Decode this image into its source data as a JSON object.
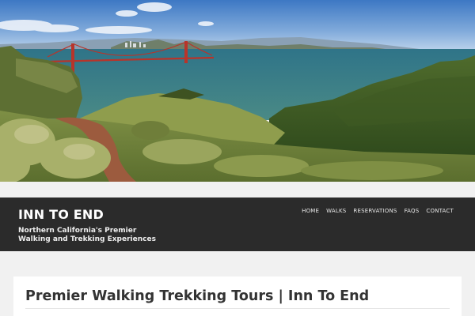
{
  "hero": {
    "image_description": "Golden Gate Bridge panorama"
  },
  "site": {
    "title": "INN TO END",
    "tagline": [
      "Northern California's Premier",
      "Walking and Trekking Experiences"
    ]
  },
  "nav": {
    "items": [
      {
        "label": "HOME"
      },
      {
        "label": "WALKS"
      },
      {
        "label": "RESERVATIONS"
      },
      {
        "label": "FAQS"
      },
      {
        "label": "CONTACT"
      }
    ]
  },
  "content": {
    "title": "Premier Walking Trekking Tours | Inn To End"
  },
  "colors": {
    "header_bg": "#2b2b2b",
    "page_bg": "#f1f1f1",
    "bridge": "#c0362c",
    "bay_water": "#3f7f86"
  }
}
